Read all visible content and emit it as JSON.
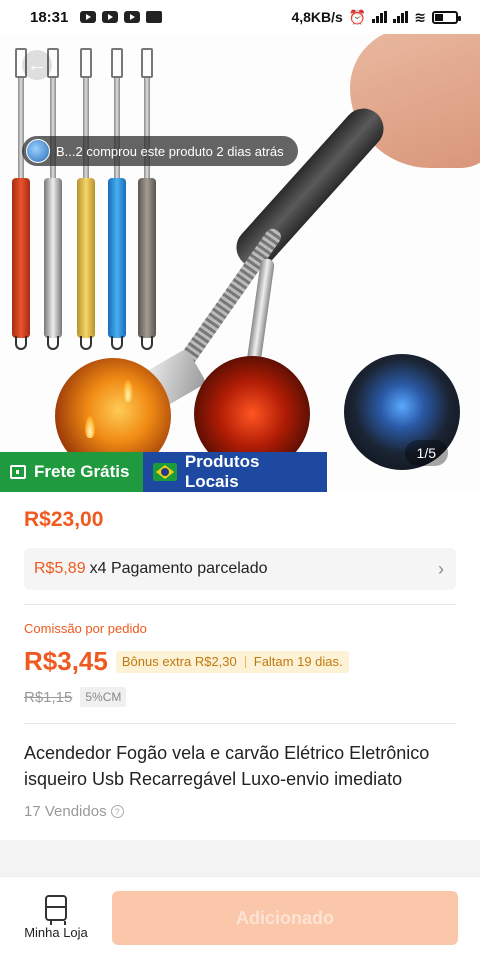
{
  "status_bar": {
    "time": "18:31",
    "net_speed": "4,8KB/s",
    "battery": "battery-icon"
  },
  "gallery": {
    "toast": "B...2 comprou este produto 2 dias atrás",
    "counter": "1/5",
    "back_icon": "back-arrow-icon"
  },
  "badges": {
    "frete": "Frete Grátis",
    "locais": "Produtos Locais"
  },
  "product": {
    "price": "R$23,00",
    "installment_price": "R$5,89",
    "installment_text": "x4 Pagamento parcelado",
    "commission_label": "Comissão por pedido",
    "commission_value": "R$3,45",
    "bonus": "Bônus extra R$2,30",
    "remaining": "Faltam 19 dias.",
    "old_commission": "R$1,15",
    "cm_rate": "5%CM",
    "title": "Acendedor Fogão vela e carvão Elétrico Eletrônico isqueiro Usb Recarregável Luxo-envio imediato",
    "sold": "17 Vendidos"
  },
  "bottom_bar": {
    "store_label": "Minha Loja",
    "add_label": "Adicionado"
  },
  "colors": {
    "accent": "#ee5a1f",
    "frete_badge": "#1f9a3e",
    "locais_badge": "#1d4aa0",
    "add_button": "#fbc7ab"
  }
}
